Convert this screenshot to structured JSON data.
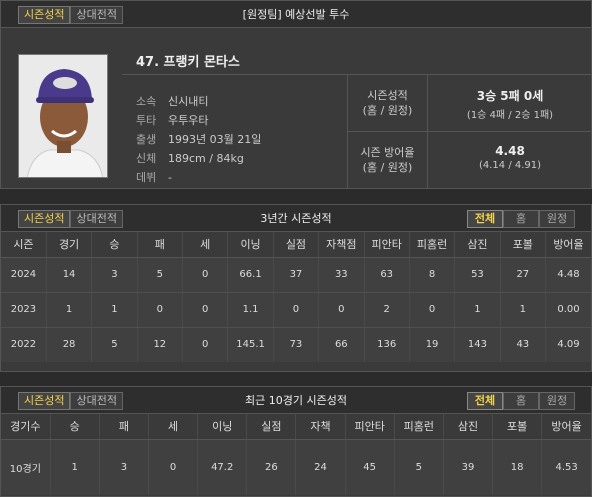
{
  "header": {
    "tabs": [
      "시즌성적",
      "상대전적"
    ],
    "title": "[원정팀] 예상선발 투수"
  },
  "player": {
    "name": "47. 프랭키 몬타스",
    "info": [
      {
        "key": "소속",
        "value": "신시내티"
      },
      {
        "key": "투타",
        "value": "우투우타"
      },
      {
        "key": "출생",
        "value": "1993년 03월 21일"
      },
      {
        "key": "신체",
        "value": "189cm / 84kg"
      },
      {
        "key": "데뷔",
        "value": "-"
      }
    ],
    "season_label1": "시즌성적",
    "season_label2": "(홈 / 원정)",
    "season_record": "3승 5패 0세",
    "season_record_split": "(1승 4패 / 2승 1패)",
    "era_label1": "시즌 방어율",
    "era_label2": "(홈 / 원정)",
    "era": "4.48",
    "era_split": "(4.14 / 4.91)"
  },
  "three_year": {
    "tabs": [
      "시즌성적",
      "상대전적"
    ],
    "title": "3년간 시즌성적",
    "filters": [
      "전체",
      "홈",
      "원정"
    ],
    "columns": [
      "시즌",
      "경기",
      "승",
      "패",
      "세",
      "이닝",
      "실점",
      "자책점",
      "피안타",
      "피홈런",
      "삼진",
      "포볼",
      "방어율"
    ],
    "rows": [
      [
        "2024",
        "14",
        "3",
        "5",
        "0",
        "66.1",
        "37",
        "33",
        "63",
        "8",
        "53",
        "27",
        "4.48"
      ],
      [
        "2023",
        "1",
        "1",
        "0",
        "0",
        "1.1",
        "0",
        "0",
        "2",
        "0",
        "1",
        "1",
        "0.00"
      ],
      [
        "2022",
        "28",
        "5",
        "12",
        "0",
        "145.1",
        "73",
        "66",
        "136",
        "19",
        "143",
        "43",
        "4.09"
      ]
    ]
  },
  "recent": {
    "tabs": [
      "시즌성적",
      "상대전적"
    ],
    "title": "최근 10경기 시즌성적",
    "filters": [
      "전체",
      "홈",
      "원정"
    ],
    "columns": [
      "경기수",
      "승",
      "패",
      "세",
      "이닝",
      "실점",
      "자책",
      "피안타",
      "피홈런",
      "삼진",
      "포볼",
      "방어율"
    ],
    "rows": [
      [
        "10경기",
        "1",
        "3",
        "0",
        "47.2",
        "26",
        "24",
        "45",
        "5",
        "39",
        "18",
        "4.53"
      ]
    ]
  }
}
